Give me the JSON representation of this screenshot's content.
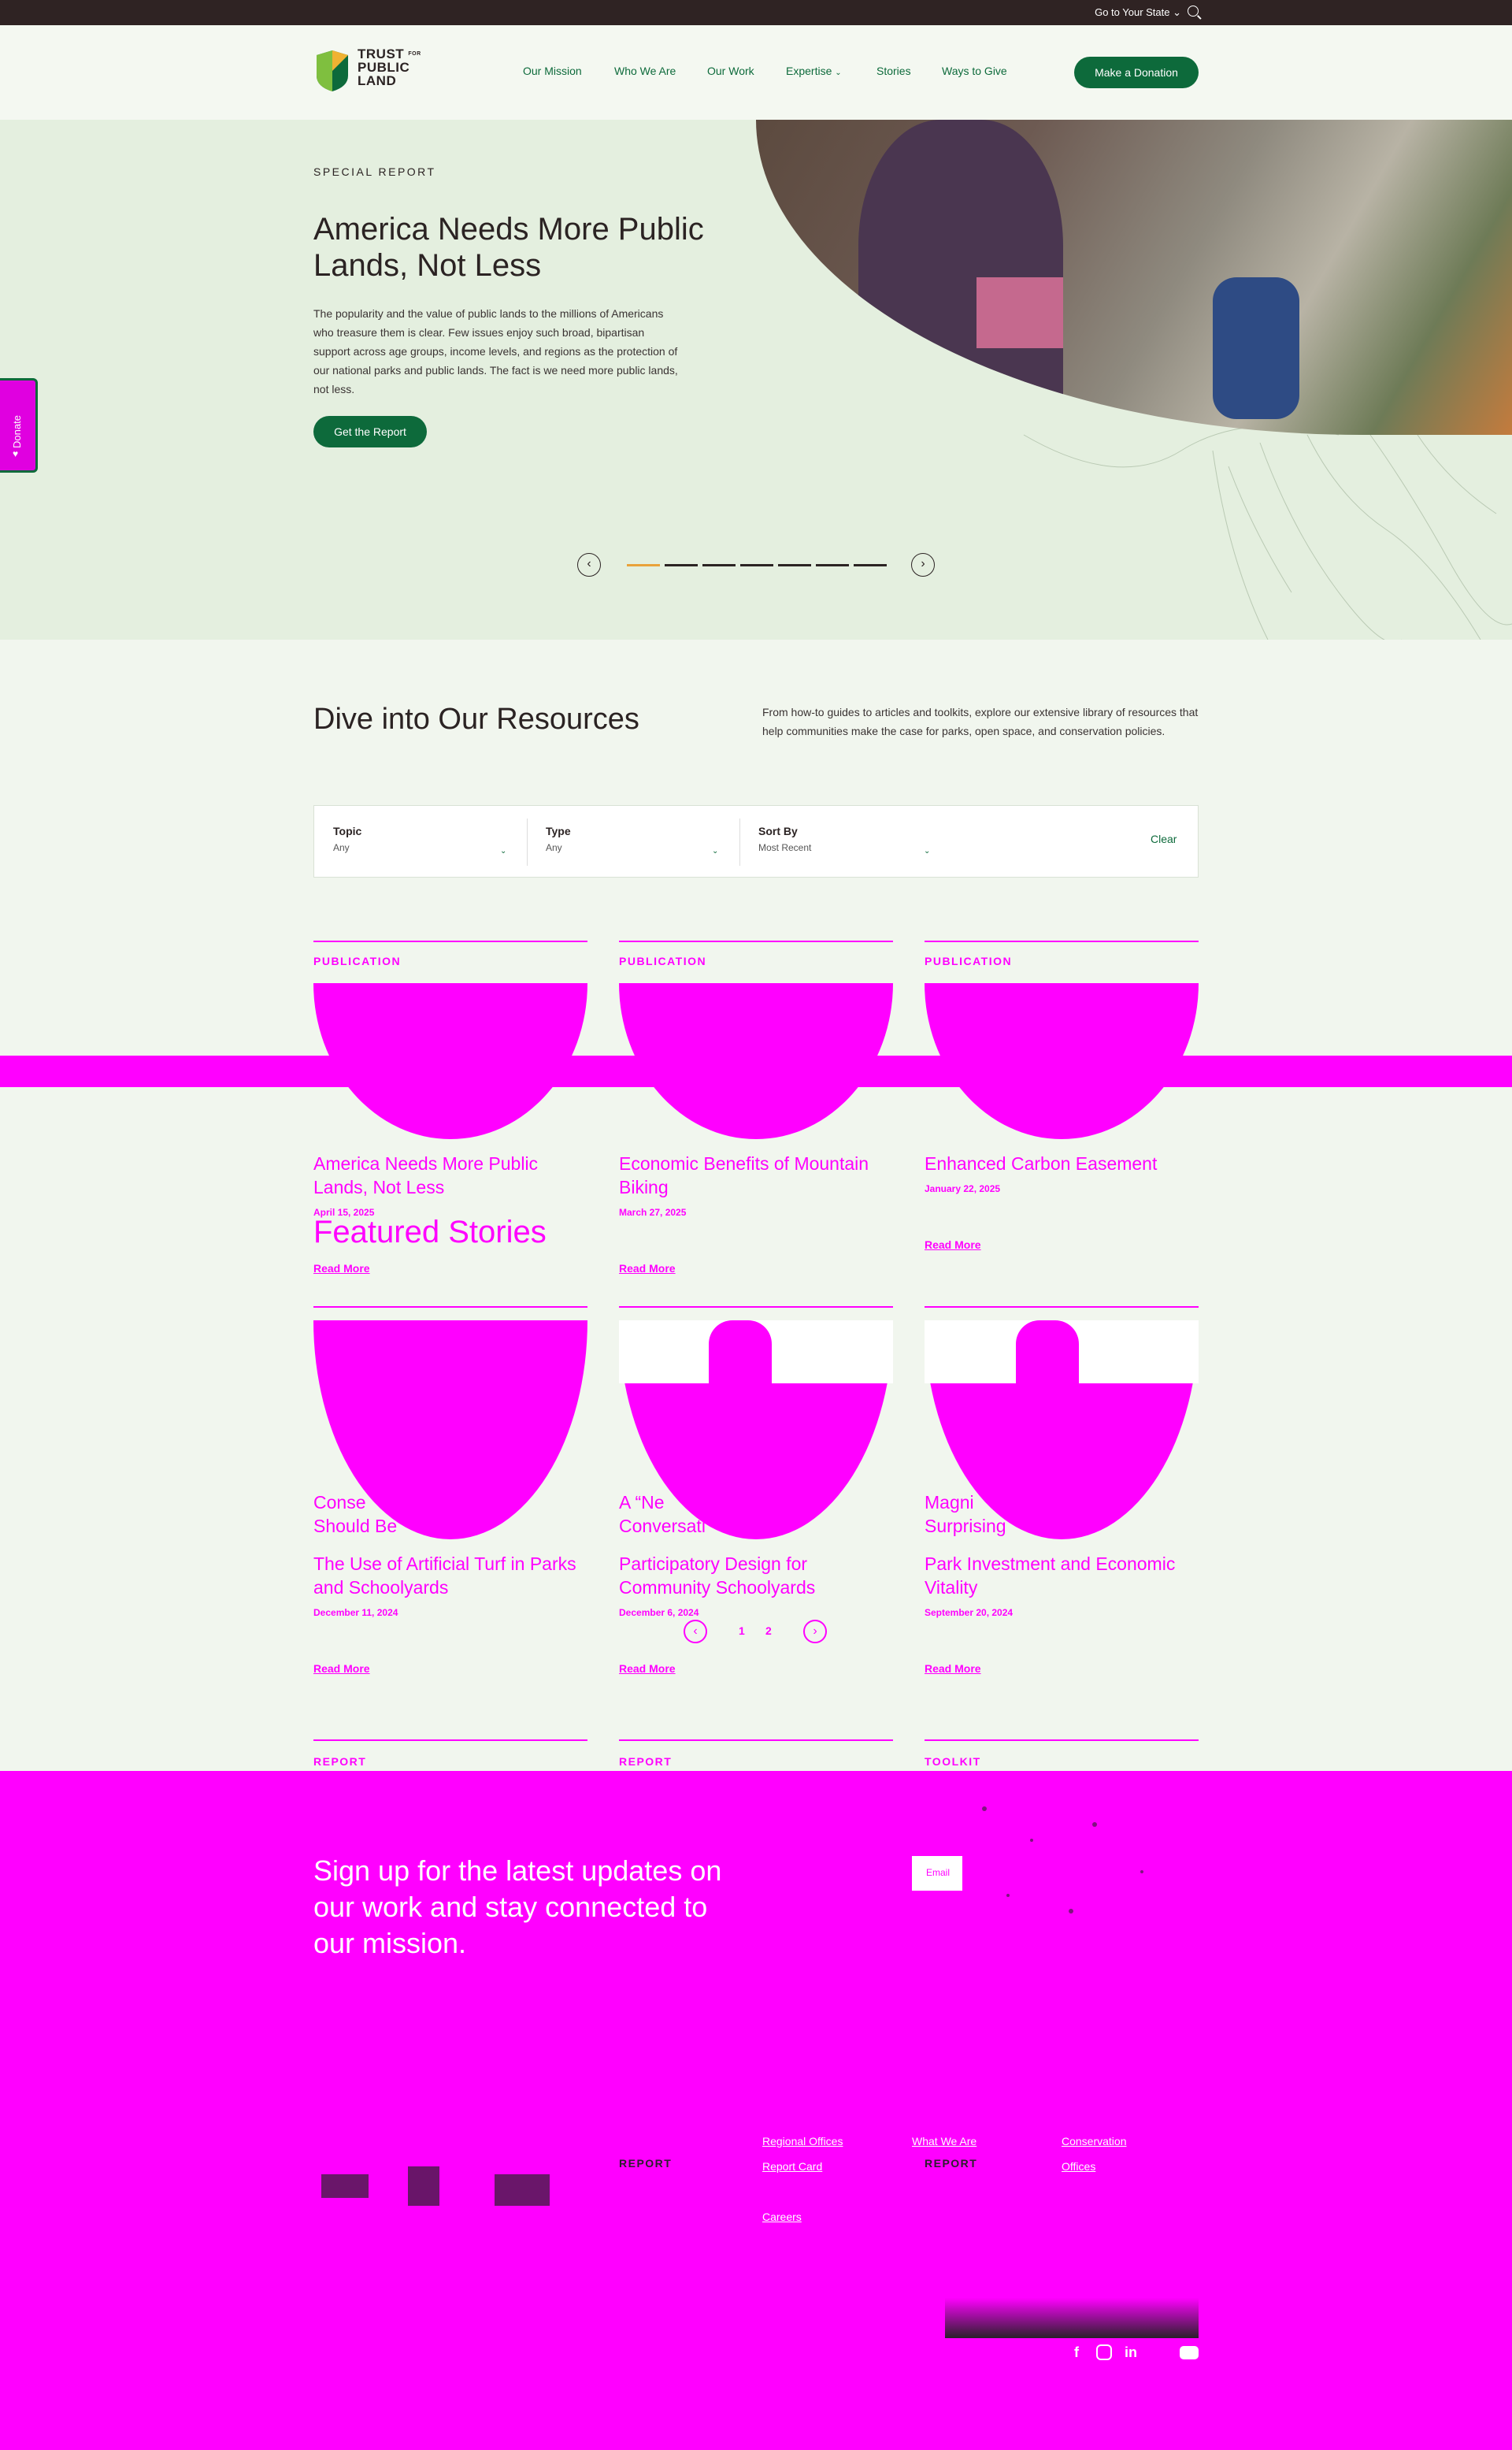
{
  "topbar": {
    "state_label": "Go to Your State"
  },
  "header": {
    "logo": {
      "line1": "TRUST",
      "for": "FOR",
      "line2": "PUBLIC",
      "line3": "LAND"
    },
    "nav": [
      "Our Mission",
      "Who We Are",
      "Our Work",
      "Expertise",
      "Stories",
      "Ways to Give"
    ],
    "donate_label": "Make a Donation"
  },
  "side_donate": {
    "label": "Donate"
  },
  "hero": {
    "eyebrow": "SPECIAL REPORT",
    "title": "America Needs More Public Lands, Not Less",
    "body": "The popularity and the value of public lands to the millions of Americans who treasure them is clear. Few issues enjoy such broad, bipartisan support across age groups, income levels, and regions as the protection of our national parks and public lands. The fact is we need more public lands, not less.",
    "cta": "Get the Report",
    "slides_total": 7,
    "slide_active": 1,
    "prev_icon": "chevron-left-icon",
    "next_icon": "chevron-right-icon"
  },
  "resources": {
    "title": "Dive into Our Resources",
    "description": "From how-to guides to articles and toolkits, explore our extensive library of resources that help communities make the case for parks, open space, and conservation policies.",
    "filters": [
      {
        "label": "Topic",
        "value": "Any"
      },
      {
        "label": "Type",
        "value": "Any"
      },
      {
        "label": "Sort By",
        "value": "Most Recent"
      }
    ],
    "clear": "Clear",
    "cards_row1": [
      {
        "category": "PUBLICATION",
        "title": "America Needs More Public Lands, Not Less",
        "date": "April 15, 2025",
        "link": "Read More"
      },
      {
        "category": "PUBLICATION",
        "title": "Economic Benefits of Mountain Biking",
        "date": "March 27, 2025",
        "link": "Read More"
      },
      {
        "category": "PUBLICATION",
        "title": "Enhanced Carbon Easement",
        "date": "January 22, 2025",
        "link": "Read More"
      }
    ],
    "cards_row2": [
      {
        "title": "The Use of Artificial Turf in Parks and Schoolyards",
        "date": "December 11, 2024",
        "link": "Read More"
      },
      {
        "title": "Participatory Design for Community Schoolyards",
        "date": "December 6, 2024",
        "link": "Read More"
      },
      {
        "title": "Park Investment and Economic Vitality",
        "date": "September 20, 2024",
        "link": "Read More"
      }
    ],
    "row3_categories": [
      "REPORT",
      "REPORT",
      "TOOLKIT"
    ]
  },
  "featured": {
    "title": "Featured Stories",
    "fragments": [
      "Conse",
      "Should Be",
      "A “Ne",
      "Conversati",
      "Magni",
      "Surprising"
    ],
    "pages": [
      "1",
      "2"
    ]
  },
  "newsletter": {
    "title": "Sign up for the latest updates on our work and stay connected to our mission.",
    "email_placeholder": "Email"
  },
  "footer": {
    "links": [
      "Regional Offices",
      "Report Card",
      "What We Are",
      "Conservation",
      "Careers",
      "Offices"
    ],
    "badges": [
      "REPORT",
      "REPORT"
    ],
    "social": [
      "f",
      "ig",
      "in",
      "yt"
    ]
  },
  "bottom": {
    "link": "Read More"
  }
}
